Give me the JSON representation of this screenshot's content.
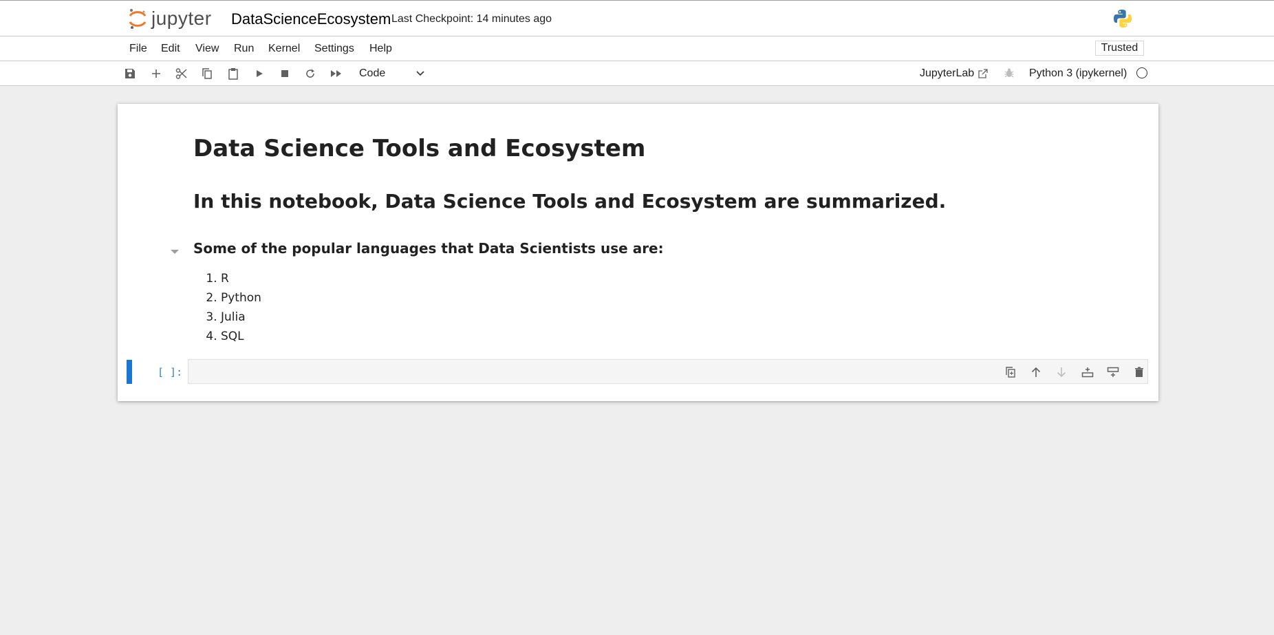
{
  "header": {
    "logo_text": "jupyter",
    "notebook_title": "DataScienceEcosystem",
    "checkpoint": "Last Checkpoint: 14 minutes ago",
    "python_icon": "python-logo-icon"
  },
  "menu": {
    "items": [
      "File",
      "Edit",
      "View",
      "Run",
      "Kernel",
      "Settings",
      "Help"
    ],
    "trusted": "Trusted"
  },
  "toolbar": {
    "buttons": [
      "save-icon",
      "add-icon",
      "cut-icon",
      "copy-icon",
      "paste-icon",
      "run-icon",
      "stop-icon",
      "restart-icon",
      "run-all-icon"
    ],
    "cell_type": "Code",
    "jupyterlab_label": "JupyterLab",
    "kernel_name": "Python 3 (ipykernel)"
  },
  "notebook": {
    "h1": "Data Science Tools and Ecosystem",
    "h2": "In this notebook, Data Science Tools and Ecosystem are summarized.",
    "h3": "Some of the popular languages that Data Scientists use are:",
    "languages": [
      "R",
      "Python",
      "Julia",
      "SQL"
    ],
    "code_prompt": "[ ]:",
    "cell_tools": [
      "duplicate-icon",
      "move-up-icon",
      "move-down-icon",
      "insert-above-icon",
      "insert-below-icon",
      "delete-icon"
    ]
  },
  "colors": {
    "accent": "#1976d2",
    "prompt": "#307fc1",
    "jupyter_orange": "#f37726"
  }
}
